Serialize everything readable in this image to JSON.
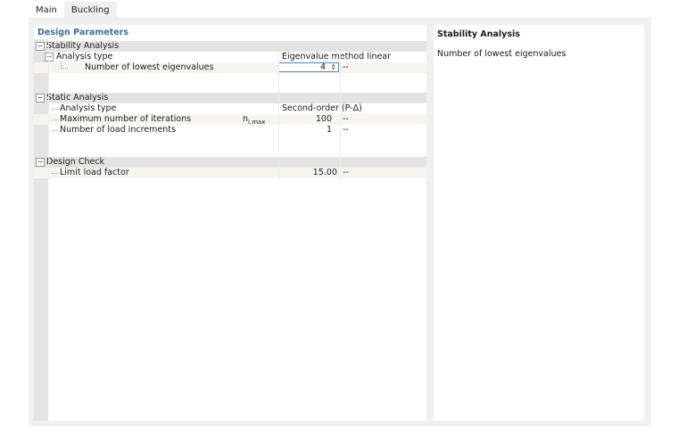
{
  "tabs": [
    {
      "label": "Main",
      "active": false
    },
    {
      "label": "Buckling",
      "active": true
    }
  ],
  "panel_title": "Design Parameters",
  "sections": {
    "stability": {
      "title": "Stability Analysis",
      "analysis_type_label": "Analysis type",
      "analysis_type_value": "Eigenvalue method linear",
      "eigen_label": "Number of lowest eigenvalues",
      "eigen_value": "4",
      "eigen_unit": "--"
    },
    "static": {
      "title": "Static Analysis",
      "analysis_type_label": "Analysis type",
      "analysis_type_value": "Second-order (P-Δ)",
      "iterations_label": "Maximum number of iterations",
      "iterations_symbol": "n",
      "iterations_symbol_sub": "i,max",
      "iterations_value": "100",
      "iterations_unit": "--",
      "increments_label": "Number of load increments",
      "increments_value": "1",
      "increments_unit": "--"
    },
    "design_check": {
      "title": "Design Check",
      "limit_label": "Limit load factor",
      "limit_value": "15.00",
      "limit_unit": "--"
    }
  },
  "toggle_symbol": "−",
  "spinner_symbol": "⇕",
  "info": {
    "title": "Stability Analysis",
    "text": "Number of lowest eigenvalues"
  },
  "colors": {
    "accent": "#3f6d9e",
    "section_bg": "#e3e3e3",
    "frame_bg": "#f0f0f0"
  }
}
